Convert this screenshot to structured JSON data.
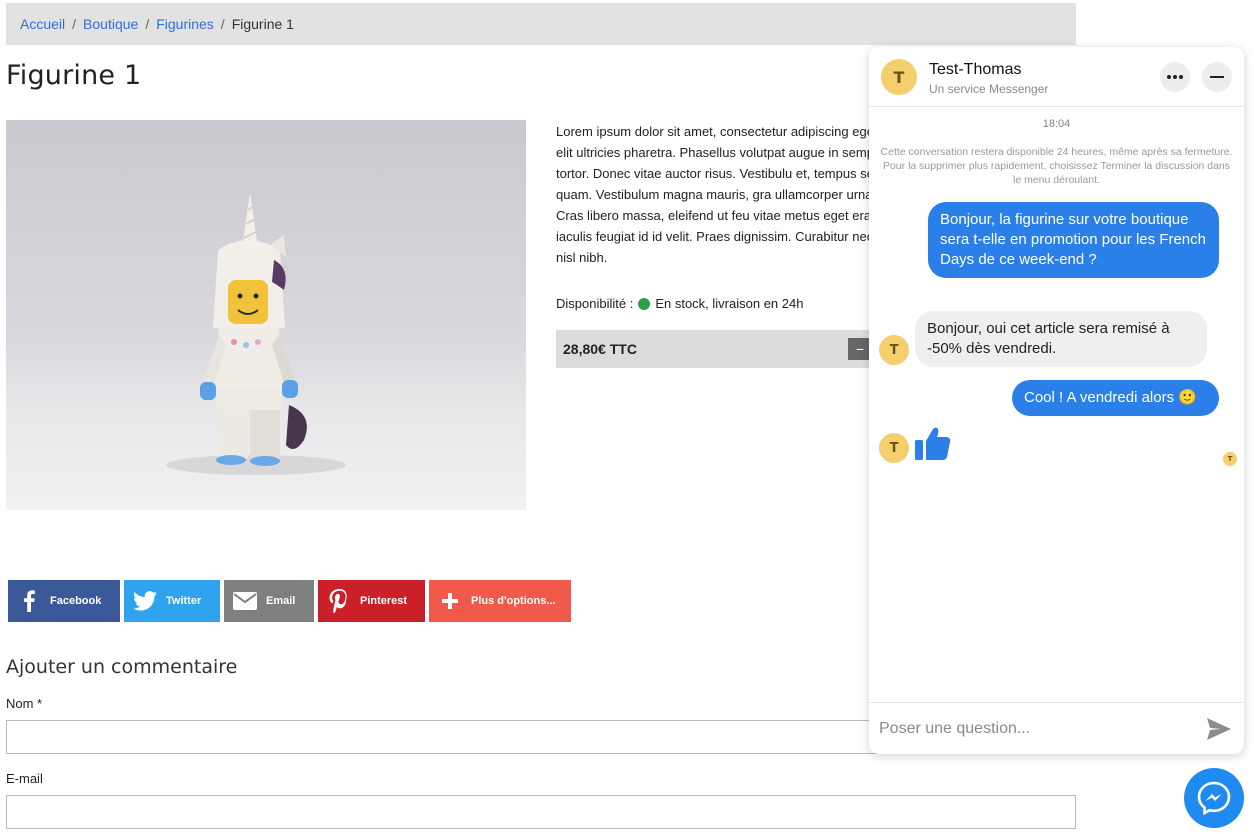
{
  "breadcrumb": {
    "items": [
      "Accueil",
      "Boutique",
      "Figurines"
    ],
    "separator": "/",
    "current": "Figurine 1"
  },
  "product": {
    "title": "Figurine 1",
    "image_icon": "unicorn-figurine-photo",
    "description": "Lorem ipsum dolor sit amet, consectetur adipiscing eget elit ultricies pharetra. Phasellus volutpat augue in semper tortor. Donec vitae auctor risus. Vestibulu et, tempus sed quam. Vestibulum magna mauris, gra ullamcorper urna. Cras libero massa, eleifend ut feu vitae metus eget erat iaculis feugiat id id velit. Praes dignissim. Curabitur nec nisl nibh.",
    "availability_label": "Disponibilité :",
    "availability_value": "En stock, livraison en 24h",
    "price": "28,80€ TTC",
    "qty_minus": "−"
  },
  "share": {
    "facebook": "Facebook",
    "twitter": "Twitter",
    "email": "Email",
    "pinterest": "Pinterest",
    "more": "Plus d'options..."
  },
  "comment_form": {
    "title": "Ajouter un commentaire",
    "name_label": "Nom *",
    "email_label": "E-mail"
  },
  "chat": {
    "contact_name": "Test-Thomas",
    "contact_sub": "Un service Messenger",
    "avatar_letter": "T",
    "timestamp": "18:04",
    "notice": "Cette conversation restera disponible 24 heures, même après sa fermeture. Pour la supprimer plus rapidement, choisissez Terminer la discussion dans le menu déroulant.",
    "messages": [
      {
        "from": "me",
        "text": "Bonjour, la figurine sur votre boutique sera t-elle en promotion pour les French Days de ce week-end ?"
      },
      {
        "from": "them",
        "text": "Bonjour, oui cet article sera remisé à -50% dès vendredi."
      },
      {
        "from": "me",
        "text": "Cool ! A vendredi alors 🙂"
      },
      {
        "from": "them",
        "text": "thumbs-up"
      }
    ],
    "input_placeholder": "Poser une question...",
    "colors": {
      "accent": "#2a7fe8",
      "avatar": "#f5cf6e"
    }
  }
}
